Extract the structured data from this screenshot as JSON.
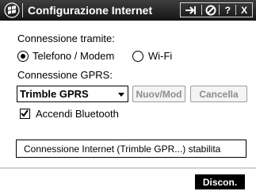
{
  "titlebar": {
    "title": "Configurazione Internet",
    "start_icon": "windows-flag-icon",
    "tray": {
      "connectivity_icon": "connection-arrow-icon",
      "volume_icon": "volume-icon",
      "help_label": "?",
      "close_label": "X"
    }
  },
  "form": {
    "connection_label": "Connessione tramite:",
    "connection_options": [
      {
        "label": "Telefono / Modem",
        "checked": true
      },
      {
        "label": "Wi-Fi",
        "checked": false
      }
    ],
    "gprs_label": "Connessione GPRS:",
    "gprs_selected": "Trimble GPRS",
    "new_mod_label": "Nuov/Mod",
    "cancel_label": "Cancella",
    "bluetooth_label": "Accendi Bluetooth",
    "bluetooth_checked": true,
    "status_text": "Connessione Internet (Trimble GPR...) stabilita"
  },
  "bottom": {
    "disconnect_label": "Discon."
  },
  "colors": {
    "titlebar": "#1e1e1e",
    "button_primary": "#000000",
    "disabled_text": "#8c8c8c"
  }
}
